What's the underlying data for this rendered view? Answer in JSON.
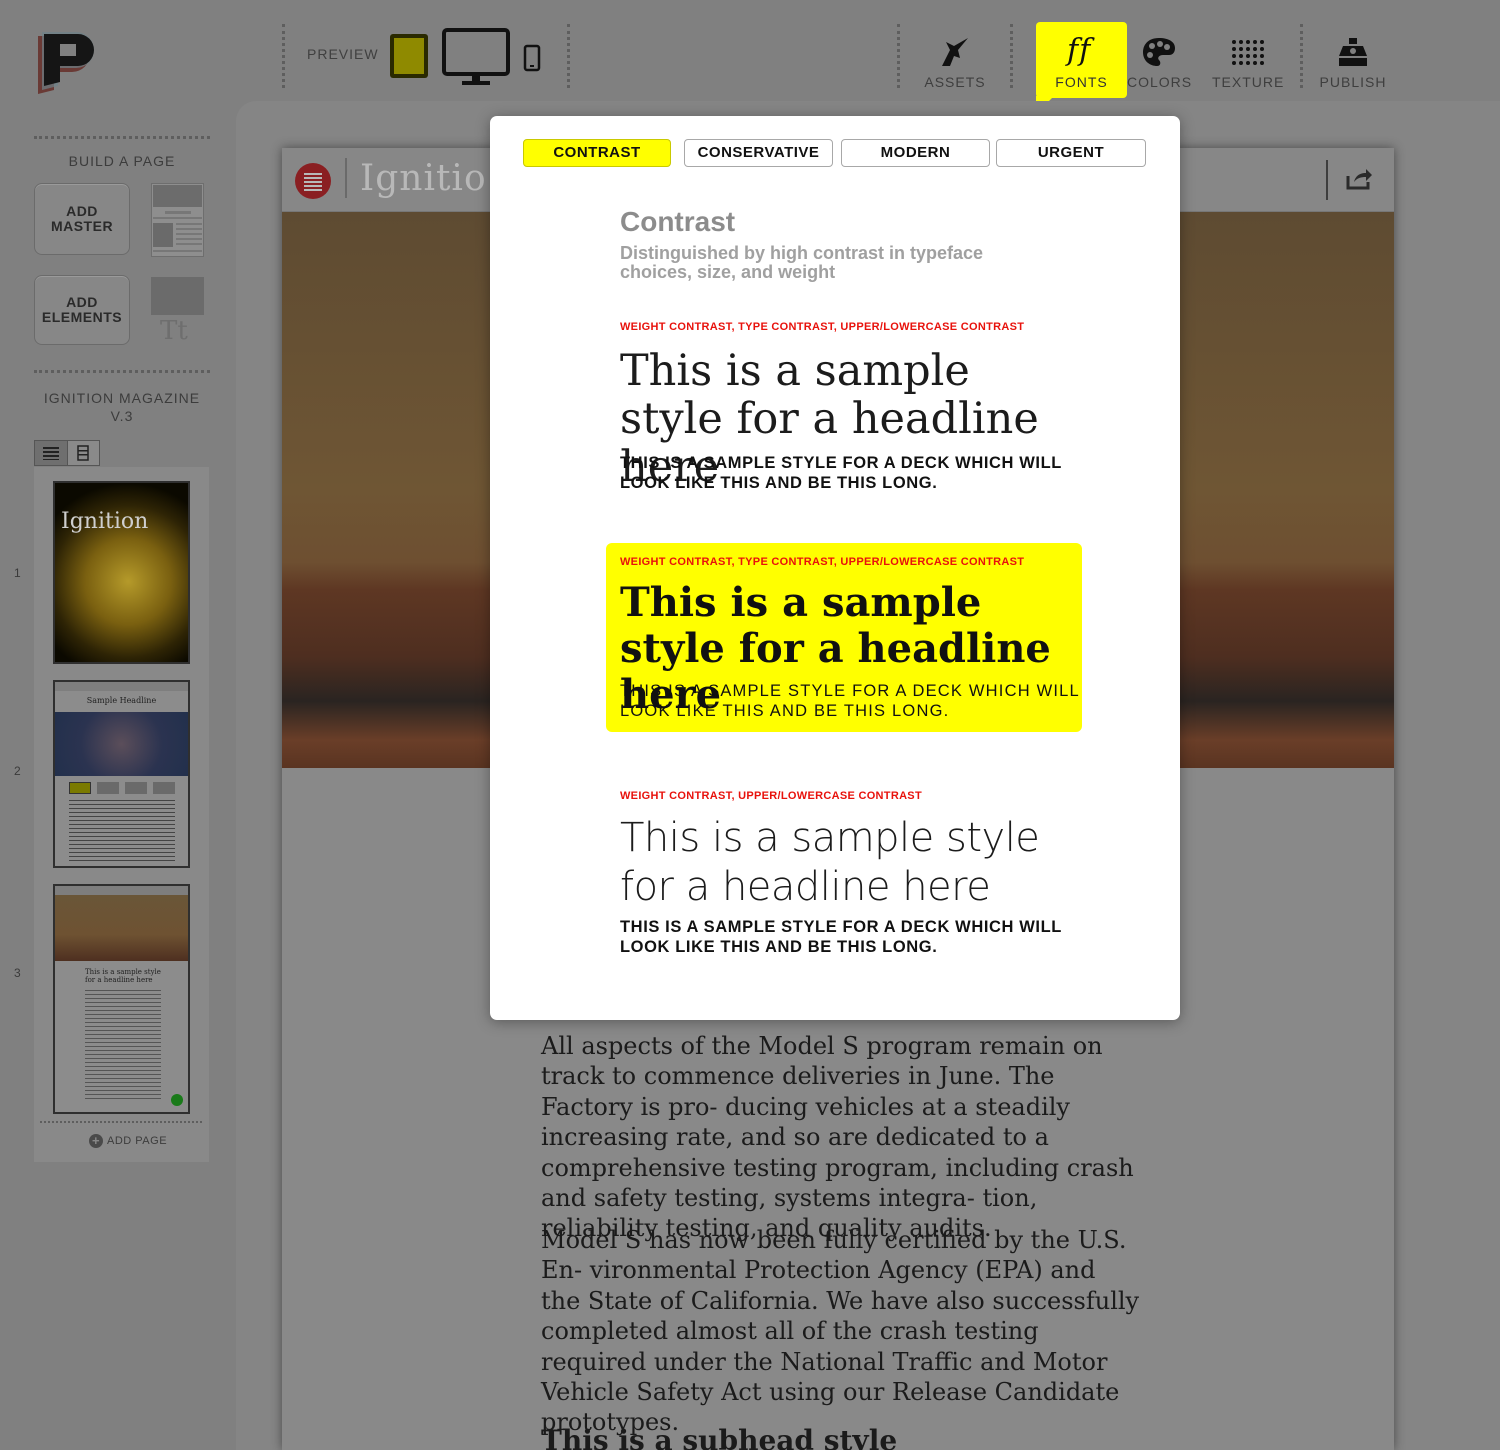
{
  "toolbar": {
    "preview_label": "PREVIEW",
    "devices": [
      "tablet-icon",
      "desktop-icon",
      "phone-icon"
    ],
    "tools": [
      {
        "label": "ASSETS",
        "icon": "unicorn-icon"
      },
      {
        "label": "FONTS",
        "icon": "font-ff-icon",
        "active": true
      },
      {
        "label": "COLORS",
        "icon": "palette-icon"
      },
      {
        "label": "TEXTURE",
        "icon": "texture-dots-icon"
      },
      {
        "label": "PUBLISH",
        "icon": "press-icon"
      }
    ]
  },
  "sidebar": {
    "build_label": "BUILD A PAGE",
    "add_master": "ADD\nMASTER",
    "add_elements": "ADD\nELEMENTS",
    "elements_glyph": "Tt",
    "magazine_label": "IGNITION MAGAZINE\nV.3",
    "pages": [
      {
        "number": "1",
        "cover_title": "Ignition"
      },
      {
        "number": "2",
        "headline": "Sample Headline"
      },
      {
        "number": "3",
        "headline": "This is a sample style for a headline here"
      }
    ],
    "add_page": "ADD PAGE"
  },
  "document": {
    "title": "Ignitio",
    "paragraphs": [
      "All aspects of the Model S program remain on track to commence deliveries in June. The Factory is pro- ducing vehicles at a steadily increasing rate, and so are dedicated to a comprehensive testing program, including crash and safety testing, systems integra- tion, reliability testing, and quality audits.",
      "Model S has now been fully certified by the U.S. En- vironmental Protection Agency (EPA) and the State of California. We have also successfully completed almost all of the crash testing required under the National Traffic and Motor Vehicle Safety Act using our Release Candidate prototypes."
    ],
    "subhead": "This is a subhead style"
  },
  "modal": {
    "tabs": [
      "CONTRAST",
      "CONSERVATIVE",
      "MODERN",
      "URGENT"
    ],
    "active_tab": "CONTRAST",
    "title": "Contrast",
    "description": "Distinguished by high contrast in typeface choices, size, and weight",
    "options": [
      {
        "tags": "WEIGHT CONTRAST, TYPE CONTRAST, UPPER/LOWERCASE CONTRAST",
        "headline": "This is a sample style for a headline here",
        "deck": "THIS IS A SAMPLE STYLE FOR A DECK WHICH WILL LOOK LIKE THIS AND BE THIS LONG."
      },
      {
        "tags": "WEIGHT CONTRAST, TYPE CONTRAST, UPPER/LOWERCASE CONTRAST",
        "headline": "This is a sample style for a headline here",
        "deck": "THIS IS A SAMPLE STYLE FOR A DECK WHICH WILL LOOK LIKE THIS AND BE THIS LONG.",
        "selected": true
      },
      {
        "tags": "WEIGHT CONTRAST, UPPER/LOWERCASE CONTRAST",
        "headline": "This is a sample style for a headline here",
        "deck": "THIS IS A SAMPLE STYLE FOR A DECK WHICH WILL LOOK LIKE THIS AND BE THIS LONG."
      }
    ]
  },
  "colors": {
    "accent": "#ffff00",
    "tag_red": "#e8120c",
    "overlay_gray": "#808080"
  }
}
